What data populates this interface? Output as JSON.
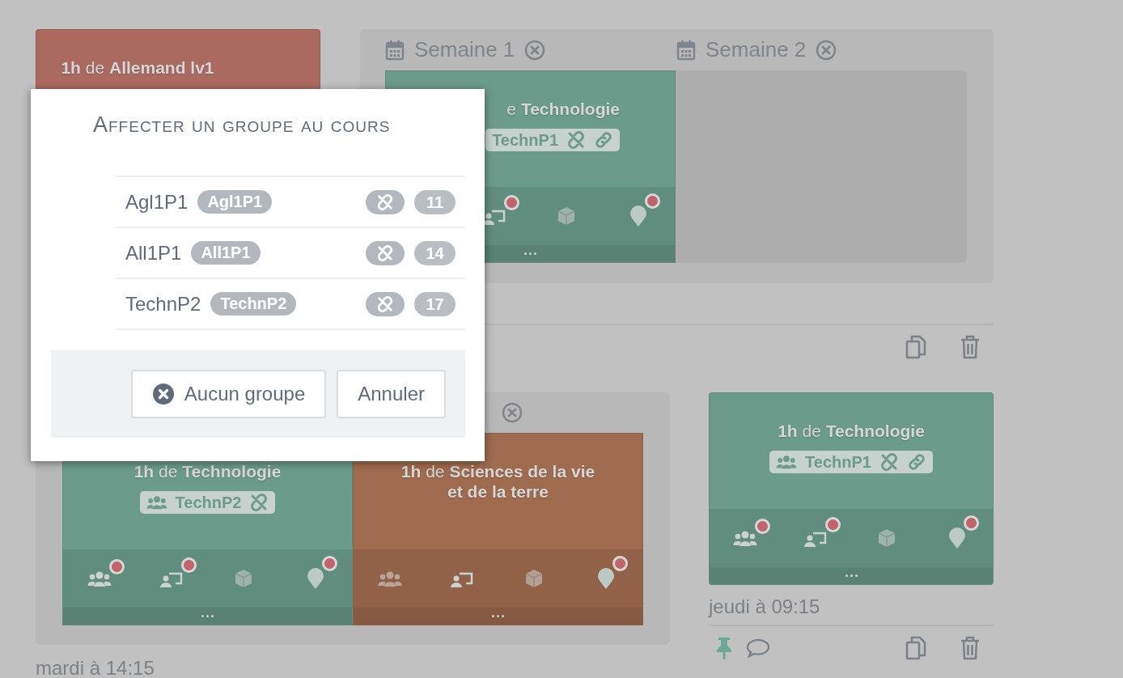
{
  "top_card": {
    "title": "**1h** de **Allemand lv1**",
    "color": "#aa6a60"
  },
  "week_panel": {
    "weeks": [
      {
        "label": "Semaine 1"
      },
      {
        "label": "Semaine 2"
      }
    ],
    "slots": [
      {
        "kind": "course",
        "partial": true,
        "color": "#6b9b8b",
        "title": "e **Technologie**",
        "badge": {
          "label": "TechnP1",
          "group": false,
          "unlink": true,
          "link": true
        },
        "resources": [
          {
            "kind": "display",
            "alert": true
          },
          {
            "kind": "box",
            "alert": false
          },
          {
            "kind": "pin",
            "alert": true
          }
        ]
      },
      {
        "kind": "empty"
      }
    ]
  },
  "lower_panel": {
    "slots": [
      {
        "kind": "course",
        "partial": false,
        "color": "#6b9b8b",
        "title": "**1h** de **Technologie**",
        "badge": {
          "label": "TechnP2",
          "group": true,
          "unlink": true,
          "link": false
        },
        "resources": [
          {
            "kind": "group",
            "alert": true
          },
          {
            "kind": "display",
            "alert": true
          },
          {
            "kind": "box",
            "alert": false
          },
          {
            "kind": "pin",
            "alert": true
          }
        ]
      },
      {
        "kind": "course",
        "partial": false,
        "color": "#a06c4f",
        "title": "**1h** de **Sciences de la vie et de la terre**",
        "resources": [
          {
            "kind": "group",
            "alert": false
          },
          {
            "kind": "display",
            "alert": false
          },
          {
            "kind": "box",
            "alert": false
          },
          {
            "kind": "pin",
            "alert": true
          }
        ]
      }
    ],
    "time": "mardi à 14:15"
  },
  "single_entry": {
    "card": {
      "kind": "course",
      "partial": false,
      "color": "#6b9b8b",
      "title": "**1h** de **Technologie**",
      "badge": {
        "label": "TechnP1",
        "group": true,
        "unlink": true,
        "link": true
      },
      "resources": [
        {
          "kind": "group",
          "alert": true
        },
        {
          "kind": "display",
          "alert": true
        },
        {
          "kind": "box",
          "alert": false
        },
        {
          "kind": "pin",
          "alert": true
        }
      ]
    },
    "time": "jeudi à 09:15",
    "pinned": true
  },
  "modal": {
    "title": "Affecter un groupe au cours",
    "groups": [
      {
        "name": "Agl1P1",
        "tag": "Agl1P1",
        "unlinked": true,
        "count": "11"
      },
      {
        "name": "All1P1",
        "tag": "All1P1",
        "unlinked": true,
        "count": "14"
      },
      {
        "name": "TechnP2",
        "tag": "TechnP2",
        "unlinked": true,
        "count": "17"
      }
    ],
    "buttons": [
      {
        "kind": "clear",
        "label": "Aucun groupe"
      },
      {
        "kind": "cancel",
        "label": "Annuler"
      }
    ]
  }
}
